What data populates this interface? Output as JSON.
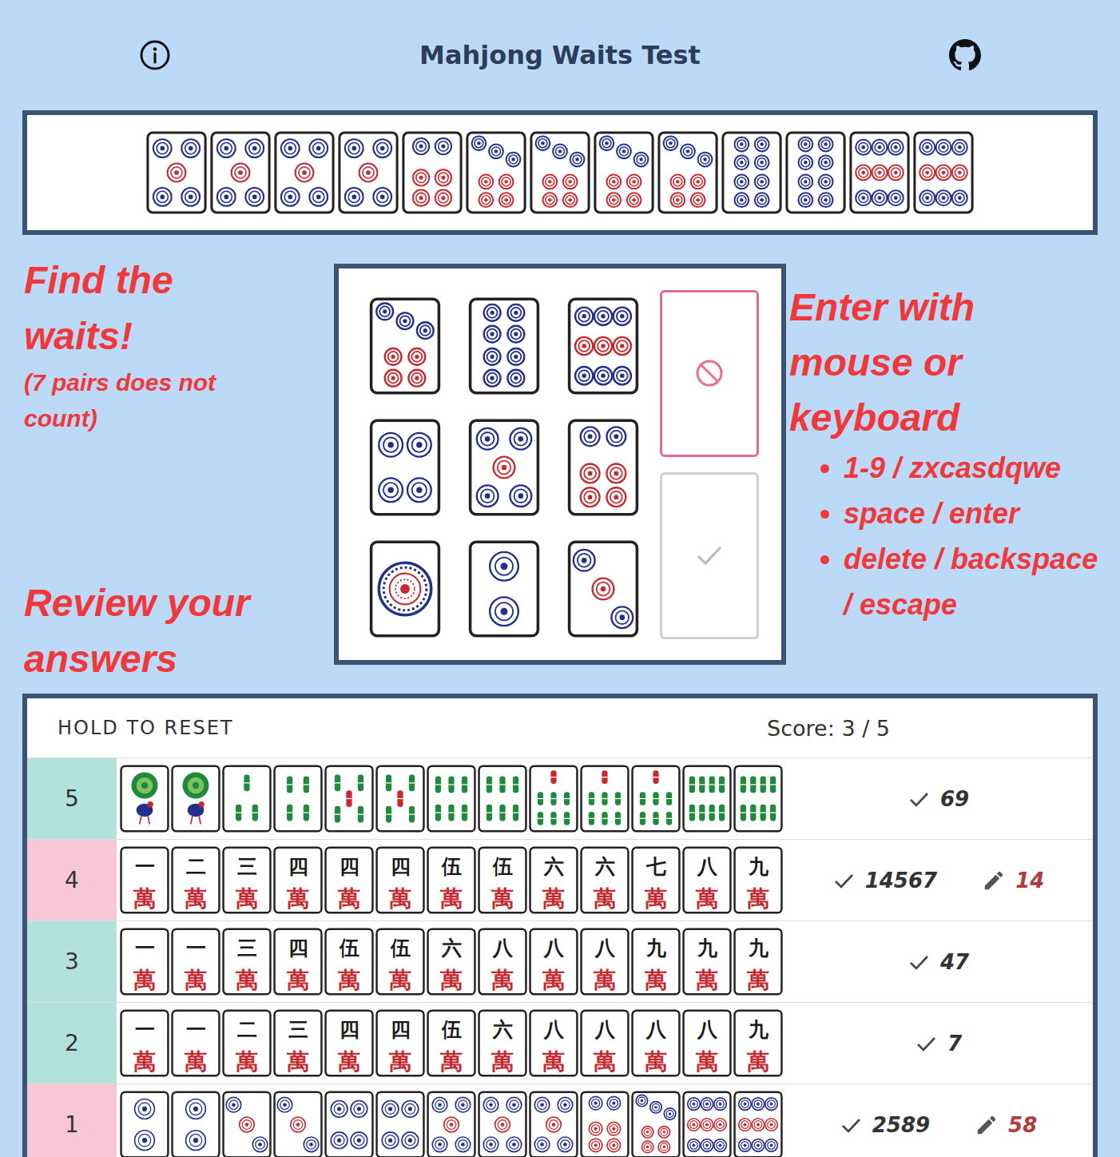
{
  "header": {
    "title": "Mahjong Waits Test"
  },
  "hand": {
    "tiles": [
      {
        "suit": "pin",
        "rank": 5
      },
      {
        "suit": "pin",
        "rank": 5
      },
      {
        "suit": "pin",
        "rank": 5
      },
      {
        "suit": "pin",
        "rank": 5
      },
      {
        "suit": "pin",
        "rank": 6
      },
      {
        "suit": "pin",
        "rank": 7
      },
      {
        "suit": "pin",
        "rank": 7
      },
      {
        "suit": "pin",
        "rank": 7
      },
      {
        "suit": "pin",
        "rank": 7
      },
      {
        "suit": "pin",
        "rank": 8
      },
      {
        "suit": "pin",
        "rank": 8
      },
      {
        "suit": "pin",
        "rank": 9
      },
      {
        "suit": "pin",
        "rank": 9
      }
    ]
  },
  "annotations": {
    "find": "Find the waits!",
    "note": "(7 pairs does not count)",
    "review": "Review your answers",
    "enter": "Enter with mouse or keyboard",
    "keys": [
      "1-9 / zxcasdqwe",
      "space / enter",
      "delete / backspace / escape"
    ]
  },
  "keypad": {
    "tiles": [
      {
        "suit": "pin",
        "rank": 7
      },
      {
        "suit": "pin",
        "rank": 8
      },
      {
        "suit": "pin",
        "rank": 9
      },
      {
        "suit": "pin",
        "rank": 4
      },
      {
        "suit": "pin",
        "rank": 5
      },
      {
        "suit": "pin",
        "rank": 6
      },
      {
        "suit": "pin",
        "rank": 1
      },
      {
        "suit": "pin",
        "rank": 2
      },
      {
        "suit": "pin",
        "rank": 3
      }
    ],
    "clear": {
      "disabled": false
    },
    "submit": {
      "disabled": true
    }
  },
  "review": {
    "reset_label": "HOLD TO RESET",
    "score": "Score: 3 / 5",
    "rows": [
      {
        "number": "5",
        "correct": true,
        "answer": "69",
        "tiles": [
          {
            "suit": "sou",
            "rank": 1
          },
          {
            "suit": "sou",
            "rank": 1
          },
          {
            "suit": "sou",
            "rank": 3
          },
          {
            "suit": "sou",
            "rank": 4
          },
          {
            "suit": "sou",
            "rank": 5
          },
          {
            "suit": "sou",
            "rank": 5
          },
          {
            "suit": "sou",
            "rank": 6
          },
          {
            "suit": "sou",
            "rank": 6
          },
          {
            "suit": "sou",
            "rank": 7
          },
          {
            "suit": "sou",
            "rank": 7
          },
          {
            "suit": "sou",
            "rank": 7
          },
          {
            "suit": "sou",
            "rank": 8
          },
          {
            "suit": "sou",
            "rank": 8
          }
        ]
      },
      {
        "number": "4",
        "correct": false,
        "answer": "14567",
        "guess": "14",
        "tiles": [
          {
            "suit": "man",
            "numeral": "一",
            "character": "萬"
          },
          {
            "suit": "man",
            "numeral": "二",
            "character": "萬"
          },
          {
            "suit": "man",
            "numeral": "三",
            "character": "萬"
          },
          {
            "suit": "man",
            "numeral": "四",
            "character": "萬"
          },
          {
            "suit": "man",
            "numeral": "四",
            "character": "萬"
          },
          {
            "suit": "man",
            "numeral": "四",
            "character": "萬"
          },
          {
            "suit": "man",
            "numeral": "伍",
            "character": "萬"
          },
          {
            "suit": "man",
            "numeral": "伍",
            "character": "萬"
          },
          {
            "suit": "man",
            "numeral": "六",
            "character": "萬"
          },
          {
            "suit": "man",
            "numeral": "六",
            "character": "萬"
          },
          {
            "suit": "man",
            "numeral": "七",
            "character": "萬"
          },
          {
            "suit": "man",
            "numeral": "八",
            "character": "萬"
          },
          {
            "suit": "man",
            "numeral": "九",
            "character": "萬"
          }
        ]
      },
      {
        "number": "3",
        "correct": true,
        "answer": "47",
        "tiles": [
          {
            "suit": "man",
            "numeral": "一",
            "character": "萬"
          },
          {
            "suit": "man",
            "numeral": "一",
            "character": "萬"
          },
          {
            "suit": "man",
            "numeral": "三",
            "character": "萬"
          },
          {
            "suit": "man",
            "numeral": "四",
            "character": "萬"
          },
          {
            "suit": "man",
            "numeral": "伍",
            "character": "萬"
          },
          {
            "suit": "man",
            "numeral": "伍",
            "character": "萬"
          },
          {
            "suit": "man",
            "numeral": "六",
            "character": "萬"
          },
          {
            "suit": "man",
            "numeral": "八",
            "character": "萬"
          },
          {
            "suit": "man",
            "numeral": "八",
            "character": "萬"
          },
          {
            "suit": "man",
            "numeral": "八",
            "character": "萬"
          },
          {
            "suit": "man",
            "numeral": "九",
            "character": "萬"
          },
          {
            "suit": "man",
            "numeral": "九",
            "character": "萬"
          },
          {
            "suit": "man",
            "numeral": "九",
            "character": "萬"
          }
        ]
      },
      {
        "number": "2",
        "correct": true,
        "answer": "7",
        "tiles": [
          {
            "suit": "man",
            "numeral": "一",
            "character": "萬"
          },
          {
            "suit": "man",
            "numeral": "一",
            "character": "萬"
          },
          {
            "suit": "man",
            "numeral": "二",
            "character": "萬"
          },
          {
            "suit": "man",
            "numeral": "三",
            "character": "萬"
          },
          {
            "suit": "man",
            "numeral": "四",
            "character": "萬"
          },
          {
            "suit": "man",
            "numeral": "四",
            "character": "萬"
          },
          {
            "suit": "man",
            "numeral": "伍",
            "character": "萬"
          },
          {
            "suit": "man",
            "numeral": "六",
            "character": "萬"
          },
          {
            "suit": "man",
            "numeral": "八",
            "character": "萬"
          },
          {
            "suit": "man",
            "numeral": "八",
            "character": "萬"
          },
          {
            "suit": "man",
            "numeral": "八",
            "character": "萬"
          },
          {
            "suit": "man",
            "numeral": "八",
            "character": "萬"
          },
          {
            "suit": "man",
            "numeral": "九",
            "character": "萬"
          }
        ]
      },
      {
        "number": "1",
        "correct": false,
        "answer": "2589",
        "guess": "58",
        "tiles": [
          {
            "suit": "pin",
            "rank": 2
          },
          {
            "suit": "pin",
            "rank": 2
          },
          {
            "suit": "pin",
            "rank": 3
          },
          {
            "suit": "pin",
            "rank": 3
          },
          {
            "suit": "pin",
            "rank": 4
          },
          {
            "suit": "pin",
            "rank": 4
          },
          {
            "suit": "pin",
            "rank": 5
          },
          {
            "suit": "pin",
            "rank": 5
          },
          {
            "suit": "pin",
            "rank": 5
          },
          {
            "suit": "pin",
            "rank": 6
          },
          {
            "suit": "pin",
            "rank": 7
          },
          {
            "suit": "pin",
            "rank": 9
          },
          {
            "suit": "pin",
            "rank": 9
          }
        ]
      }
    ]
  }
}
